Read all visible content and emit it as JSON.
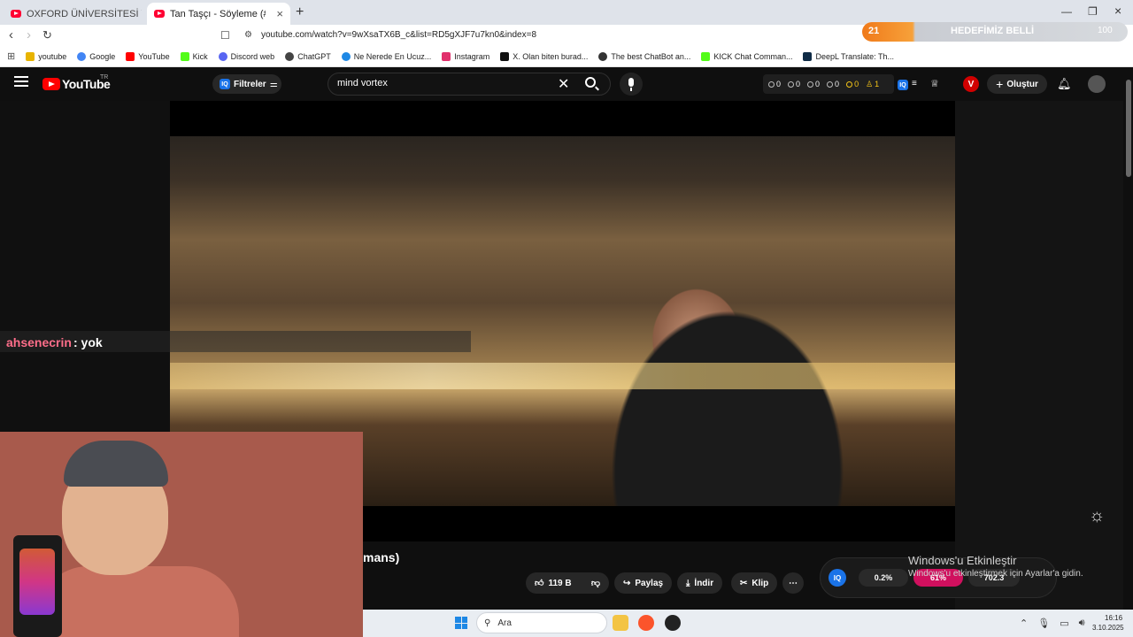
{
  "browser": {
    "tabs": [
      {
        "label": "OXFORD ÜNİVERSİTESİ YURT ODASI"
      },
      {
        "label": "Tan Taşçı - Söyleme (#SözMü"
      }
    ],
    "new_tab": "+",
    "address": "youtube.com/watch?v=9wXsaTX6B_c&list=RD5gXJF7u7kn0&index=8",
    "goal_bar": {
      "count": "21",
      "label": "HEDEFİMİZ BELLİ",
      "right": "100"
    },
    "bookmarks": [
      {
        "label": "youtube",
        "color": "#e8b400"
      },
      {
        "label": "Google",
        "color": "#4285f4"
      },
      {
        "label": "YouTube",
        "color": "#ff0000"
      },
      {
        "label": "Kick",
        "color": "#53fc18"
      },
      {
        "label": "Discord web",
        "color": "#5865f2"
      },
      {
        "label": "ChatGPT",
        "color": "#444444"
      },
      {
        "label": "Ne Nerede En Ucuz...",
        "color": "#1e88e5"
      },
      {
        "label": "Instagram",
        "color": "#e1306c"
      },
      {
        "label": "X. Olan biten burad...",
        "color": "#111111"
      },
      {
        "label": "The best ChatBot an...",
        "color": "#333333"
      },
      {
        "label": "KICK Chat Comman...",
        "color": "#53fc18"
      },
      {
        "label": "DeepL Translate: Th...",
        "color": "#0f2b46"
      }
    ]
  },
  "youtube": {
    "logo": "YouTube",
    "region": "TR",
    "filter_label": "Filtreler",
    "search_value": "mind vortex",
    "stats": [
      "0",
      "0",
      "0",
      "0",
      "0",
      "1"
    ],
    "create_label": "Oluştur",
    "avatar_letter": "V"
  },
  "chat": {
    "user": "ahsenecrin",
    "message": ": yok"
  },
  "video": {
    "title_fragment": "mans)",
    "actions": {
      "likes": "119 B",
      "share": "Paylaş",
      "download": "İndir",
      "clip": "Klip",
      "more": "⋯"
    }
  },
  "overlay": {
    "windows_activate_title": "Windows'u Etkinleştir",
    "windows_activate_sub": "Windows'u etkinleştirmek için Ayarlar'a gidin.",
    "iq_badge": "IQ",
    "iq_values": [
      "0.2%",
      "61%",
      "702.3"
    ]
  },
  "taskbar": {
    "search_placeholder": "Ara",
    "time": "16:16",
    "date": "3.10.2025"
  },
  "colors": {
    "accent": "#ff0000",
    "chat_user": "#ff6e8a",
    "goal": "#f07a1a"
  }
}
